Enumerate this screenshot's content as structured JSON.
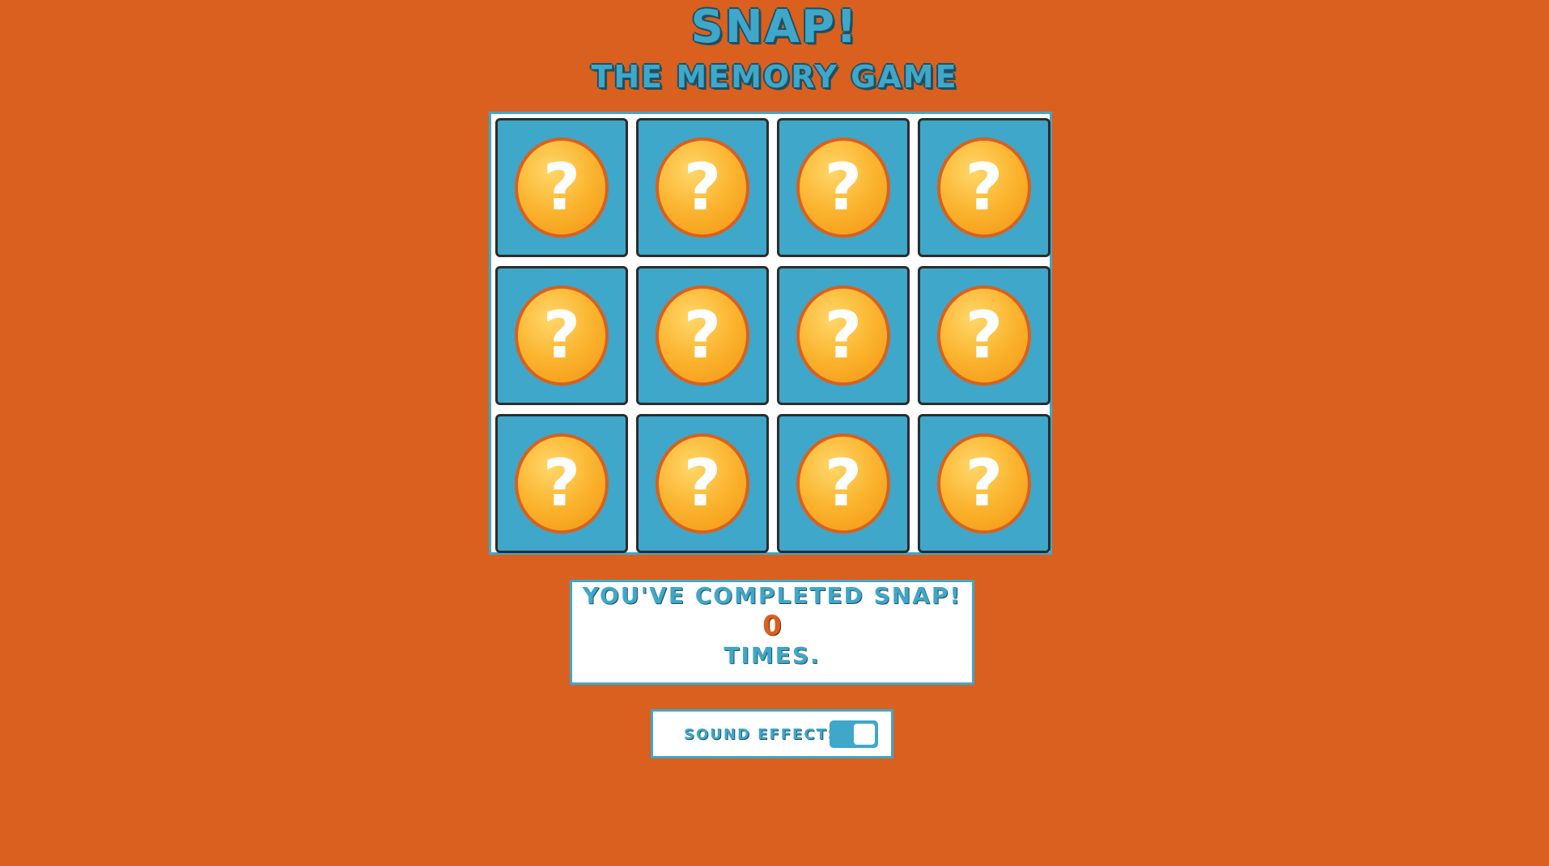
{
  "header": {
    "title": "Snap!",
    "subtitle": "The Memory Game"
  },
  "board": {
    "rows": 3,
    "columns": 4,
    "cards": [
      {
        "face": "?",
        "state": "hidden",
        "icon": "question-mark-icon"
      },
      {
        "face": "?",
        "state": "hidden",
        "icon": "question-mark-icon"
      },
      {
        "face": "?",
        "state": "hidden",
        "icon": "question-mark-icon"
      },
      {
        "face": "?",
        "state": "hidden",
        "icon": "question-mark-icon"
      },
      {
        "face": "?",
        "state": "hidden",
        "icon": "question-mark-icon"
      },
      {
        "face": "?",
        "state": "hidden",
        "icon": "question-mark-icon"
      },
      {
        "face": "?",
        "state": "hidden",
        "icon": "question-mark-icon"
      },
      {
        "face": "?",
        "state": "hidden",
        "icon": "question-mark-icon"
      },
      {
        "face": "?",
        "state": "hidden",
        "icon": "question-mark-icon"
      },
      {
        "face": "?",
        "state": "hidden",
        "icon": "question-mark-icon"
      },
      {
        "face": "?",
        "state": "hidden",
        "icon": "question-mark-icon"
      },
      {
        "face": "?",
        "state": "hidden",
        "icon": "question-mark-icon"
      }
    ]
  },
  "score": {
    "line1": "You've completed Snap!",
    "count": "0",
    "line2": "Times."
  },
  "sound": {
    "label": "Sound Effects",
    "enabled": true
  },
  "colors": {
    "background": "#d9601f",
    "accent": "#3fa7c9",
    "card_icon": "#fbb530"
  }
}
